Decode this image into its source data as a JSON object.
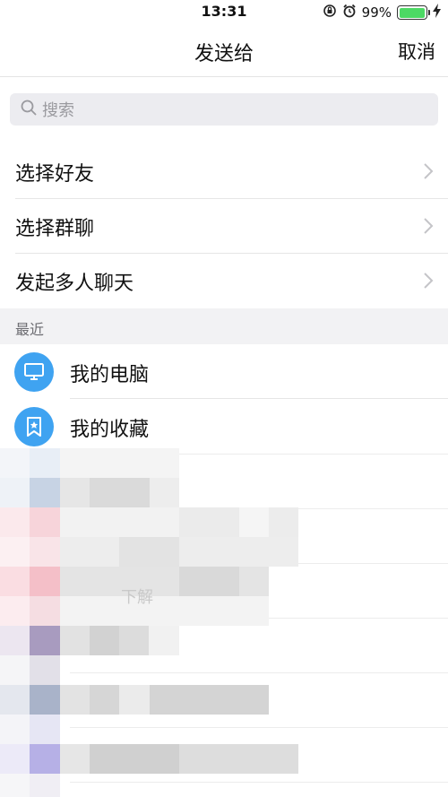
{
  "status_bar": {
    "time": "13:31",
    "battery_percent": "99%",
    "battery_level": 0.99,
    "icons": [
      "orientation-lock-icon",
      "alarm-icon",
      "battery-icon",
      "charging-icon"
    ]
  },
  "nav": {
    "title": "发送给",
    "cancel_label": "取消"
  },
  "search": {
    "placeholder": "搜索",
    "icon": "search-icon"
  },
  "options": [
    {
      "label": "选择好友"
    },
    {
      "label": "选择群聊"
    },
    {
      "label": "发起多人聊天"
    }
  ],
  "recent": {
    "header": "最近",
    "items": [
      {
        "name": "我的电脑",
        "icon": "computer-icon"
      },
      {
        "name": "我的收藏",
        "icon": "favorites-icon"
      }
    ]
  },
  "blurred_fragment": "下解",
  "colors": {
    "accent_blue": "#3fa3f1",
    "battery_green": "#4cd964",
    "section_bg": "#f2f2f4",
    "search_bg": "#ececf0"
  }
}
